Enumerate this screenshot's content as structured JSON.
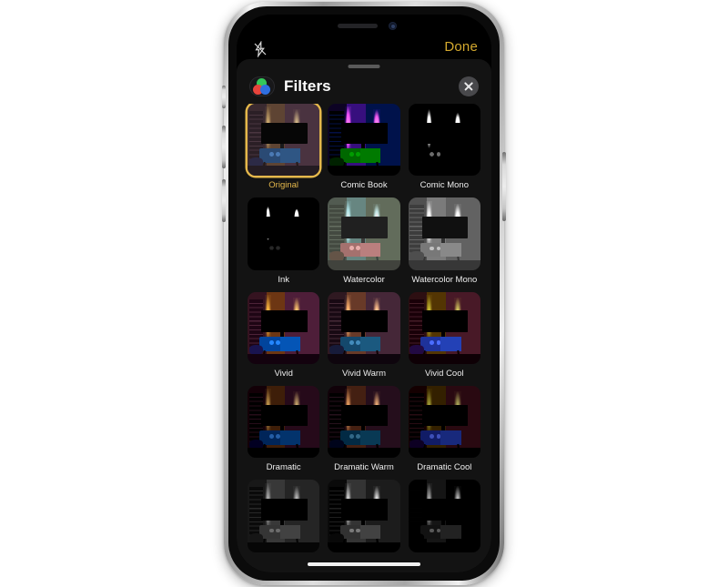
{
  "device": {
    "name": "iPhone",
    "notch": {
      "speaker": "earpiece-speaker",
      "camera": "front-camera"
    },
    "side_buttons": [
      "mute-switch",
      "volume-up",
      "volume-down",
      "power-button"
    ],
    "home_indicator": "home-indicator"
  },
  "camera_bar": {
    "flash_icon": "flash-off-icon",
    "done_label": "Done",
    "done_color": "#d4a92e"
  },
  "sheet": {
    "grabber": "drag-handle",
    "icon": "filters-icon",
    "icon_colors": {
      "green": "#35c75a",
      "red": "#e8443c",
      "blue": "#2f6fe0"
    },
    "title": "Filters",
    "close_icon": "close-icon",
    "accent_color": "#e5b84b",
    "background": "#131313"
  },
  "filters": [
    {
      "label": "Original",
      "style": "f-original",
      "selected": true
    },
    {
      "label": "Comic Book",
      "style": "f-comicbook",
      "selected": false
    },
    {
      "label": "Comic Mono",
      "style": "f-comicmono",
      "selected": false
    },
    {
      "label": "Ink",
      "style": "f-ink",
      "selected": false
    },
    {
      "label": "Watercolor",
      "style": "f-watercolor",
      "selected": false
    },
    {
      "label": "Watercolor Mono",
      "style": "f-watercolormono",
      "selected": false
    },
    {
      "label": "Vivid",
      "style": "f-vivid",
      "selected": false
    },
    {
      "label": "Vivid Warm",
      "style": "f-vividwarm",
      "selected": false
    },
    {
      "label": "Vivid Cool",
      "style": "f-vividcool",
      "selected": false
    },
    {
      "label": "Dramatic",
      "style": "f-dramatic",
      "selected": false
    },
    {
      "label": "Dramatic Warm",
      "style": "f-dramaticwarm",
      "selected": false
    },
    {
      "label": "Dramatic Cool",
      "style": "f-dramaticcool",
      "selected": false
    },
    {
      "label": "",
      "style": "f-mono",
      "selected": false
    },
    {
      "label": "",
      "style": "f-silvertone",
      "selected": false
    },
    {
      "label": "",
      "style": "f-noir",
      "selected": false
    }
  ]
}
